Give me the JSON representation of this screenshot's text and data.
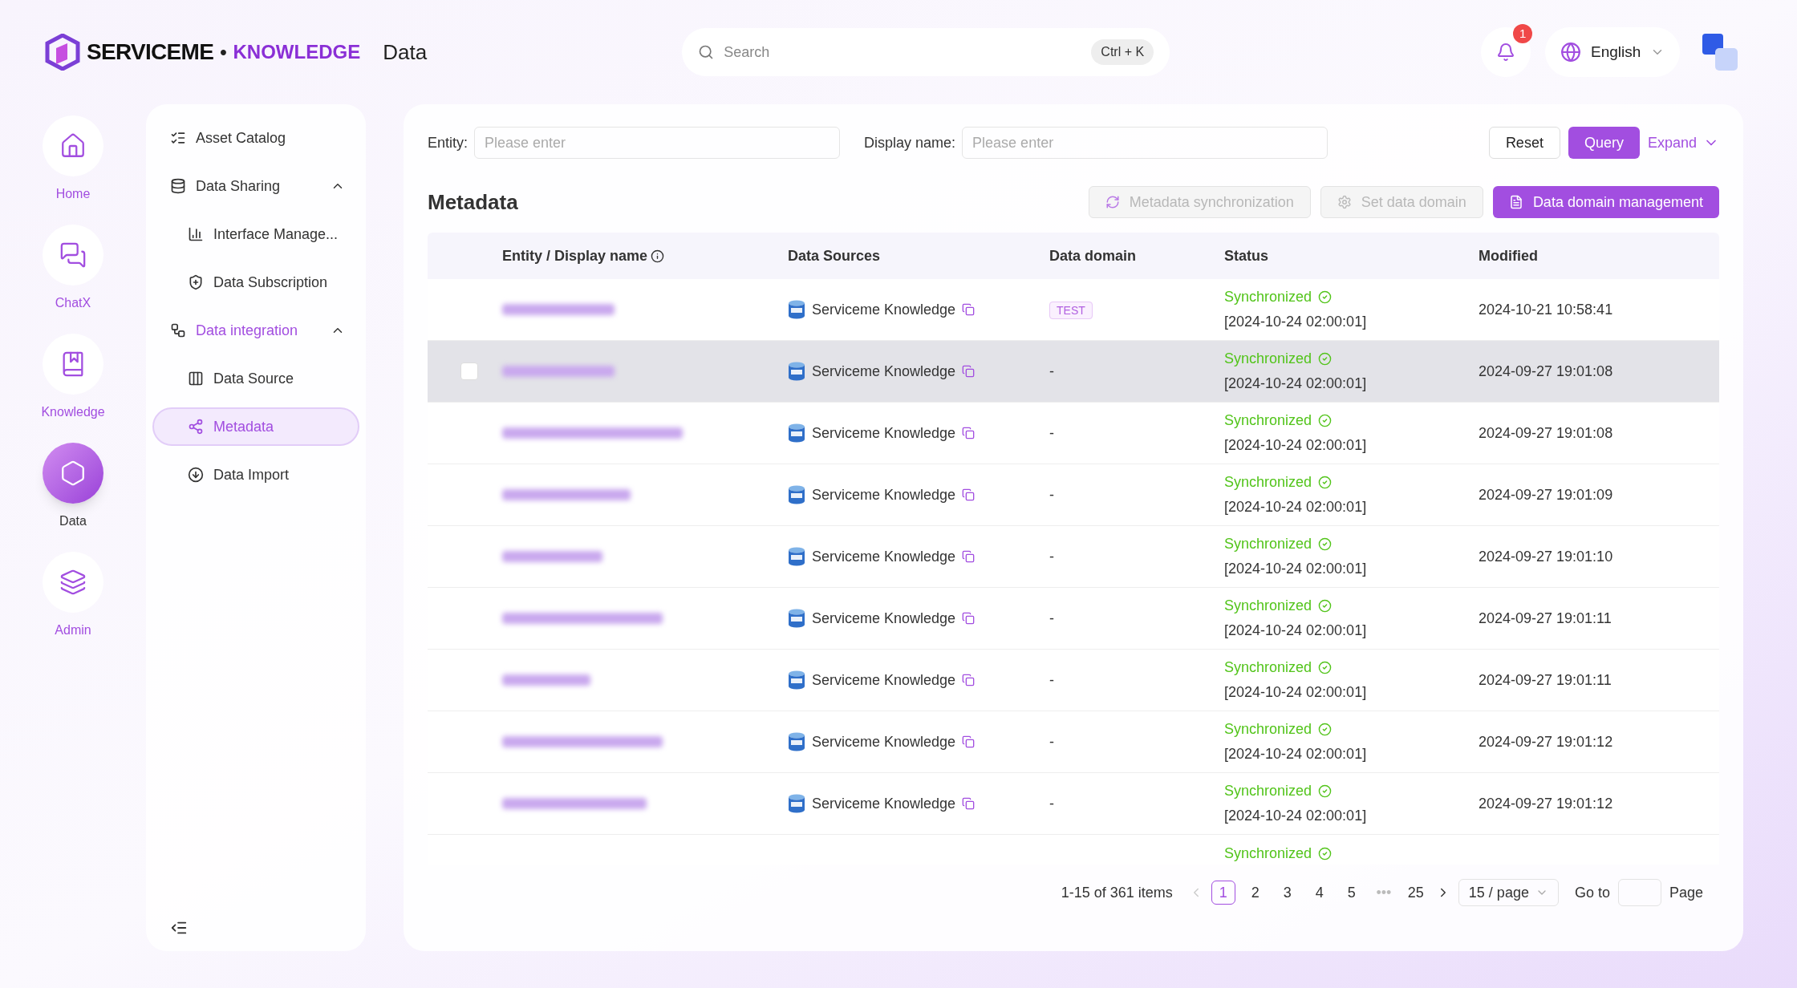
{
  "header": {
    "brand": "SERVICEME",
    "brand_dot": "•",
    "brand_product": "KNOWLEDGE",
    "page_title": "Data",
    "search": {
      "placeholder": "Search",
      "shortcut": "Ctrl + K"
    },
    "notifications": "1",
    "language": "English"
  },
  "rail": [
    {
      "label": "Home",
      "selected": false
    },
    {
      "label": "ChatX",
      "selected": false
    },
    {
      "label": "Knowledge",
      "selected": false
    },
    {
      "label": "Data",
      "selected": true
    },
    {
      "label": "Admin",
      "selected": false
    }
  ],
  "sidebar": {
    "items": [
      {
        "label": "Asset Catalog",
        "selected": false
      },
      {
        "label": "Data Sharing",
        "selected": false,
        "expanded": true,
        "children": [
          {
            "label": "Interface Manage...",
            "selected": false
          },
          {
            "label": "Data Subscription",
            "selected": false
          }
        ]
      },
      {
        "label": "Data integration",
        "selected": false,
        "expanded": true,
        "children": [
          {
            "label": "Data Source",
            "selected": false
          },
          {
            "label": "Metadata",
            "selected": true
          },
          {
            "label": "Data Import",
            "selected": false
          }
        ]
      }
    ]
  },
  "filters": [
    {
      "label": "Entity:",
      "placeholder": "Please enter"
    },
    {
      "label": "Display name:",
      "placeholder": "Please enter"
    }
  ],
  "filter_buttons": {
    "reset": "Reset",
    "query": "Query",
    "expand": "Expand"
  },
  "section_title": "Metadata",
  "actions": [
    {
      "label": "Metadata synchronization",
      "disabled": true
    },
    {
      "label": "Set data domain",
      "disabled": true
    },
    {
      "label": "Data domain management",
      "disabled": false
    }
  ],
  "table": {
    "columns": [
      "Entity / Display name",
      "Data Sources",
      "Data domain",
      "Status",
      "Modified"
    ],
    "rows": [
      {
        "kind": "tagged",
        "highlighted": false,
        "source": "Serviceme Knowledge",
        "domain": "TEST",
        "status": "Synchronized",
        "sync_time": "[2024-10-24 02:00:01]",
        "modified": "2024-10-21 10:58:41"
      },
      {
        "kind": "plain",
        "highlighted": true,
        "checked": false,
        "source": "Serviceme Knowledge",
        "domain": "-",
        "status": "Synchronized",
        "sync_time": "[2024-10-24 02:00:01]",
        "modified": "2024-09-27 19:01:08"
      },
      {
        "kind": "plain",
        "highlighted": false,
        "source": "Serviceme Knowledge",
        "domain": "-",
        "status": "Synchronized",
        "sync_time": "[2024-10-24 02:00:01]",
        "modified": "2024-09-27 19:01:08"
      },
      {
        "kind": "plain",
        "highlighted": false,
        "source": "Serviceme Knowledge",
        "domain": "-",
        "status": "Synchronized",
        "sync_time": "[2024-10-24 02:00:01]",
        "modified": "2024-09-27 19:01:09"
      },
      {
        "kind": "plain",
        "highlighted": false,
        "source": "Serviceme Knowledge",
        "domain": "-",
        "status": "Synchronized",
        "sync_time": "[2024-10-24 02:00:01]",
        "modified": "2024-09-27 19:01:10"
      },
      {
        "kind": "plain",
        "highlighted": false,
        "source": "Serviceme Knowledge",
        "domain": "-",
        "status": "Synchronized",
        "sync_time": "[2024-10-24 02:00:01]",
        "modified": "2024-09-27 19:01:11"
      },
      {
        "kind": "plain",
        "highlighted": false,
        "source": "Serviceme Knowledge",
        "domain": "-",
        "status": "Synchronized",
        "sync_time": "[2024-10-24 02:00:01]",
        "modified": "2024-09-27 19:01:11"
      },
      {
        "kind": "plain",
        "highlighted": false,
        "source": "Serviceme Knowledge",
        "domain": "-",
        "status": "Synchronized",
        "sync_time": "[2024-10-24 02:00:01]",
        "modified": "2024-09-27 19:01:12"
      },
      {
        "kind": "plain",
        "highlighted": false,
        "source": "Serviceme Knowledge",
        "domain": "-",
        "status": "Synchronized",
        "sync_time": "[2024-10-24 02:00:01]",
        "modified": "2024-09-27 19:01:12"
      },
      {
        "kind": "partial",
        "highlighted": false,
        "status": "Synchronized"
      }
    ]
  },
  "pagination": {
    "summary": "1-15 of 361 items",
    "pages": [
      {
        "label": "1",
        "selected": true
      },
      {
        "label": "2",
        "selected": false
      },
      {
        "label": "3",
        "selected": false
      },
      {
        "label": "4",
        "selected": false
      },
      {
        "label": "5",
        "selected": false
      },
      {
        "label": "•••",
        "selected": false
      },
      {
        "label": "25",
        "selected": false
      }
    ],
    "page_size": "15 / page",
    "goto": "Go to",
    "page_word": "Page"
  }
}
